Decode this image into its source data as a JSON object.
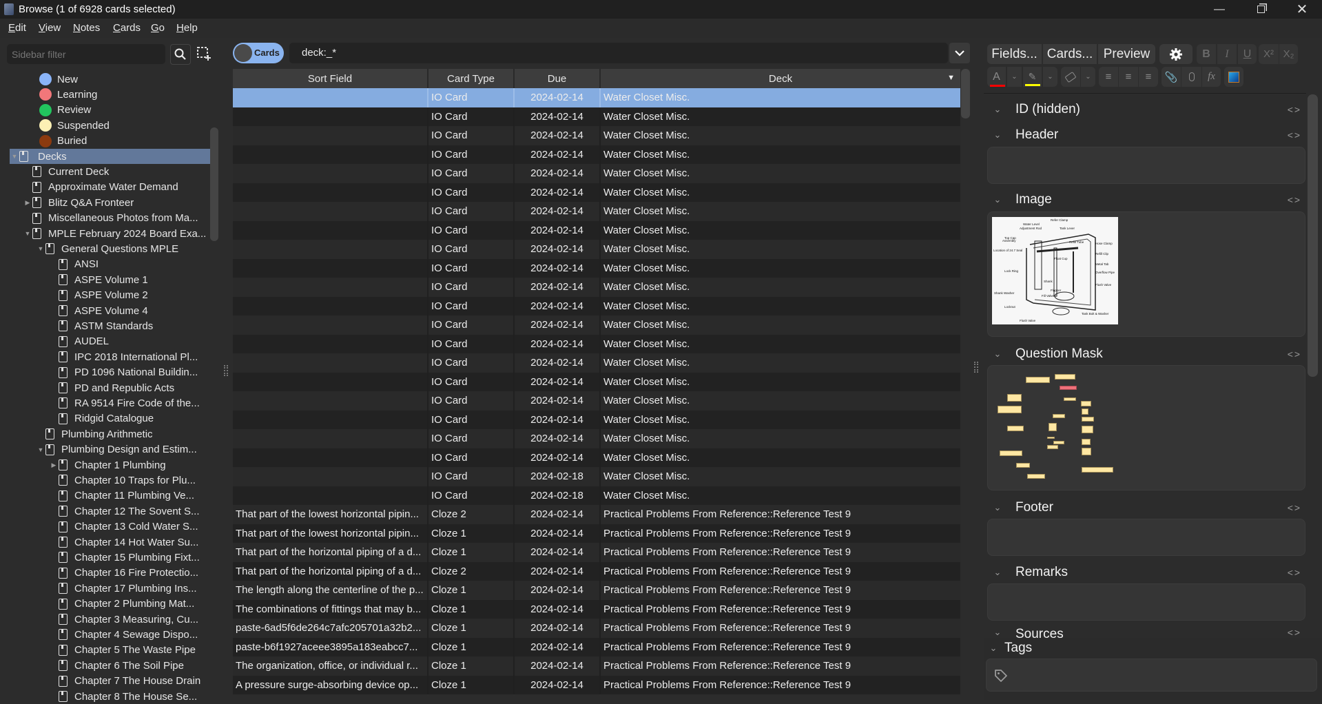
{
  "window": {
    "title": "Browse (1 of 6928 cards selected)",
    "controls": [
      "minimize",
      "restore",
      "close"
    ]
  },
  "menu": [
    "Edit",
    "View",
    "Notes",
    "Cards",
    "Go",
    "Help"
  ],
  "sidebar": {
    "filter_placeholder": "Sidebar filter",
    "states": [
      {
        "label": "New",
        "color": "#8ab4f8"
      },
      {
        "label": "Learning",
        "color": "#f2777a"
      },
      {
        "label": "Review",
        "color": "#22c55e"
      },
      {
        "label": "Suspended",
        "color": "#fcf0b4"
      },
      {
        "label": "Buried",
        "color": "#8b3a0f"
      }
    ],
    "tree": [
      {
        "label": "Decks",
        "depth": 0,
        "expander": "expanded",
        "selected": true
      },
      {
        "label": "Current Deck",
        "depth": 1,
        "expander": "none",
        "icon": "current-deck"
      },
      {
        "label": "Approximate Water Demand",
        "depth": 1,
        "expander": "none"
      },
      {
        "label": "Blitz Q&A Fronteer",
        "depth": 1,
        "expander": "collapsed"
      },
      {
        "label": "Miscellaneous Photos from Ma...",
        "depth": 1,
        "expander": "none"
      },
      {
        "label": "MPLE February 2024 Board Exa...",
        "depth": 1,
        "expander": "expanded"
      },
      {
        "label": "General Questions MPLE",
        "depth": 2,
        "expander": "expanded"
      },
      {
        "label": "ANSI",
        "depth": 3,
        "expander": "none"
      },
      {
        "label": "ASPE Volume 1",
        "depth": 3,
        "expander": "none"
      },
      {
        "label": "ASPE Volume 2",
        "depth": 3,
        "expander": "none"
      },
      {
        "label": "ASPE Volume 4",
        "depth": 3,
        "expander": "none"
      },
      {
        "label": "ASTM Standards",
        "depth": 3,
        "expander": "none"
      },
      {
        "label": "AUDEL",
        "depth": 3,
        "expander": "none"
      },
      {
        "label": "IPC 2018 International Pl...",
        "depth": 3,
        "expander": "none"
      },
      {
        "label": "PD 1096 National Buildin...",
        "depth": 3,
        "expander": "none"
      },
      {
        "label": "PD and Republic Acts",
        "depth": 3,
        "expander": "none"
      },
      {
        "label": "RA 9514 Fire Code of the...",
        "depth": 3,
        "expander": "none"
      },
      {
        "label": "Ridgid Catalogue",
        "depth": 3,
        "expander": "none"
      },
      {
        "label": "Plumbing Arithmetic",
        "depth": 2,
        "expander": "none"
      },
      {
        "label": "Plumbing Design and Estim...",
        "depth": 2,
        "expander": "expanded"
      },
      {
        "label": "Chapter 1 Plumbing",
        "depth": 3,
        "expander": "collapsed"
      },
      {
        "label": "Chapter 10 Traps for Plu...",
        "depth": 3,
        "expander": "none"
      },
      {
        "label": "Chapter 11 Plumbing Ve...",
        "depth": 3,
        "expander": "none"
      },
      {
        "label": "Chapter 12 The Sovent S...",
        "depth": 3,
        "expander": "none"
      },
      {
        "label": "Chapter 13 Cold Water S...",
        "depth": 3,
        "expander": "none"
      },
      {
        "label": "Chapter 14 Hot Water Su...",
        "depth": 3,
        "expander": "none"
      },
      {
        "label": "Chapter 15 Plumbing Fixt...",
        "depth": 3,
        "expander": "none"
      },
      {
        "label": "Chapter 16 Fire Protectio...",
        "depth": 3,
        "expander": "none"
      },
      {
        "label": "Chapter 17 Plumbing Ins...",
        "depth": 3,
        "expander": "none"
      },
      {
        "label": "Chapter 2 Plumbing Mat...",
        "depth": 3,
        "expander": "none"
      },
      {
        "label": "Chapter 3 Measuring, Cu...",
        "depth": 3,
        "expander": "none"
      },
      {
        "label": "Chapter 4 Sewage Dispo...",
        "depth": 3,
        "expander": "none"
      },
      {
        "label": "Chapter 5 The Waste Pipe",
        "depth": 3,
        "expander": "none"
      },
      {
        "label": "Chapter 6 The Soil Pipe",
        "depth": 3,
        "expander": "none"
      },
      {
        "label": "Chapter 7 The House Drain",
        "depth": 3,
        "expander": "none"
      },
      {
        "label": "Chapter 8 The House Se...",
        "depth": 3,
        "expander": "none"
      }
    ]
  },
  "toolbar": {
    "toggle_label": "Cards",
    "search_value": "deck:_*"
  },
  "table": {
    "columns": [
      "Sort Field",
      "Card Type",
      "Due",
      "Deck"
    ],
    "sorted_column": "Deck",
    "rows": [
      {
        "sort": "",
        "type": "IO Card",
        "due": "2024-02-14",
        "deck": "Water Closet Misc.",
        "selected": true
      },
      {
        "sort": "",
        "type": "IO Card",
        "due": "2024-02-14",
        "deck": "Water Closet Misc."
      },
      {
        "sort": "",
        "type": "IO Card",
        "due": "2024-02-14",
        "deck": "Water Closet Misc."
      },
      {
        "sort": "",
        "type": "IO Card",
        "due": "2024-02-14",
        "deck": "Water Closet Misc."
      },
      {
        "sort": "",
        "type": "IO Card",
        "due": "2024-02-14",
        "deck": "Water Closet Misc."
      },
      {
        "sort": "",
        "type": "IO Card",
        "due": "2024-02-14",
        "deck": "Water Closet Misc."
      },
      {
        "sort": "",
        "type": "IO Card",
        "due": "2024-02-14",
        "deck": "Water Closet Misc."
      },
      {
        "sort": "",
        "type": "IO Card",
        "due": "2024-02-14",
        "deck": "Water Closet Misc."
      },
      {
        "sort": "",
        "type": "IO Card",
        "due": "2024-02-14",
        "deck": "Water Closet Misc."
      },
      {
        "sort": "",
        "type": "IO Card",
        "due": "2024-02-14",
        "deck": "Water Closet Misc."
      },
      {
        "sort": "",
        "type": "IO Card",
        "due": "2024-02-14",
        "deck": "Water Closet Misc."
      },
      {
        "sort": "",
        "type": "IO Card",
        "due": "2024-02-14",
        "deck": "Water Closet Misc."
      },
      {
        "sort": "",
        "type": "IO Card",
        "due": "2024-02-14",
        "deck": "Water Closet Misc."
      },
      {
        "sort": "",
        "type": "IO Card",
        "due": "2024-02-14",
        "deck": "Water Closet Misc."
      },
      {
        "sort": "",
        "type": "IO Card",
        "due": "2024-02-14",
        "deck": "Water Closet Misc."
      },
      {
        "sort": "",
        "type": "IO Card",
        "due": "2024-02-14",
        "deck": "Water Closet Misc."
      },
      {
        "sort": "",
        "type": "IO Card",
        "due": "2024-02-14",
        "deck": "Water Closet Misc."
      },
      {
        "sort": "",
        "type": "IO Card",
        "due": "2024-02-14",
        "deck": "Water Closet Misc."
      },
      {
        "sort": "",
        "type": "IO Card",
        "due": "2024-02-14",
        "deck": "Water Closet Misc."
      },
      {
        "sort": "",
        "type": "IO Card",
        "due": "2024-02-14",
        "deck": "Water Closet Misc."
      },
      {
        "sort": "",
        "type": "IO Card",
        "due": "2024-02-18",
        "deck": "Water Closet Misc."
      },
      {
        "sort": "",
        "type": "IO Card",
        "due": "2024-02-18",
        "deck": "Water Closet Misc."
      },
      {
        "sort": "That part of the lowest horizontal pipin...",
        "type": "Cloze 2",
        "due": "2024-02-14",
        "deck": "Practical Problems From Reference::Reference Test 9"
      },
      {
        "sort": "That part of the lowest horizontal pipin...",
        "type": "Cloze 1",
        "due": "2024-02-14",
        "deck": "Practical Problems From Reference::Reference Test 9"
      },
      {
        "sort": "That part of the horizontal piping of a d...",
        "type": "Cloze 1",
        "due": "2024-02-14",
        "deck": "Practical Problems From Reference::Reference Test 9"
      },
      {
        "sort": "That part of the horizontal piping of a d...",
        "type": "Cloze 2",
        "due": "2024-02-14",
        "deck": "Practical Problems From Reference::Reference Test 9"
      },
      {
        "sort": "The length along the centerline of the p...",
        "type": "Cloze 1",
        "due": "2024-02-14",
        "deck": "Practical Problems From Reference::Reference Test 9"
      },
      {
        "sort": "The combinations of fittings that may b...",
        "type": "Cloze 1",
        "due": "2024-02-14",
        "deck": "Practical Problems From Reference::Reference Test 9"
      },
      {
        "sort": "paste-6ad5f6de264c7afc205701a32b2...",
        "type": "Cloze 1",
        "due": "2024-02-14",
        "deck": "Practical Problems From Reference::Reference Test 9"
      },
      {
        "sort": "paste-b6f1927aceee3895a183eabcc7...",
        "type": "Cloze 1",
        "due": "2024-02-14",
        "deck": "Practical Problems From Reference::Reference Test 9"
      },
      {
        "sort": "The organization, office, or individual r...",
        "type": "Cloze 1",
        "due": "2024-02-14",
        "deck": "Practical Problems From Reference::Reference Test 9"
      },
      {
        "sort": "A pressure surge-absorbing device op...",
        "type": "Cloze 1",
        "due": "2024-02-14",
        "deck": "Practical Problems From Reference::Reference Test 9"
      }
    ]
  },
  "editor": {
    "buttons": {
      "fields": "Fields...",
      "cards": "Cards...",
      "preview": "Preview"
    },
    "format_buttons": [
      "bold",
      "italic",
      "underline",
      "superscript",
      "subscript"
    ],
    "format_glyphs": {
      "bold": "B",
      "italic": "I",
      "underline": "U",
      "superscript": "X²",
      "subscript": "X₂"
    },
    "text_color": "#ff0000",
    "highlight_color": "#ffff00",
    "fields": [
      {
        "name": "ID (hidden)",
        "has_box": false
      },
      {
        "name": "Header",
        "has_box": true
      },
      {
        "name": "Image",
        "has_box": true,
        "content": "water closet tank diagram image"
      },
      {
        "name": "Question Mask",
        "has_box": true,
        "content": "image occlusion mask"
      },
      {
        "name": "Footer",
        "has_box": true
      },
      {
        "name": "Remarks",
        "has_box": true
      },
      {
        "name": "Sources",
        "has_box": false
      }
    ],
    "image_labels": [
      "Refer Clamp",
      "Water Level Adjustment Rod",
      "Tank Lever",
      "Top Cap Assembly",
      "Refill Tube",
      "Hose Clamp",
      "Location of 24.7 Seal",
      "Float Cup",
      "Refill Clip",
      "Metal Tab",
      "Lock Ring",
      "Overflow Pipe",
      "Shank",
      "Flapper",
      "Flush Valve",
      "Fill Valve",
      "Shank Washer",
      "Locknut",
      "Tank Bolt & Washer"
    ],
    "mask_colors": {
      "shape": "#ffe7a3",
      "active": "#f0707a"
    },
    "tags_label": "Tags"
  }
}
